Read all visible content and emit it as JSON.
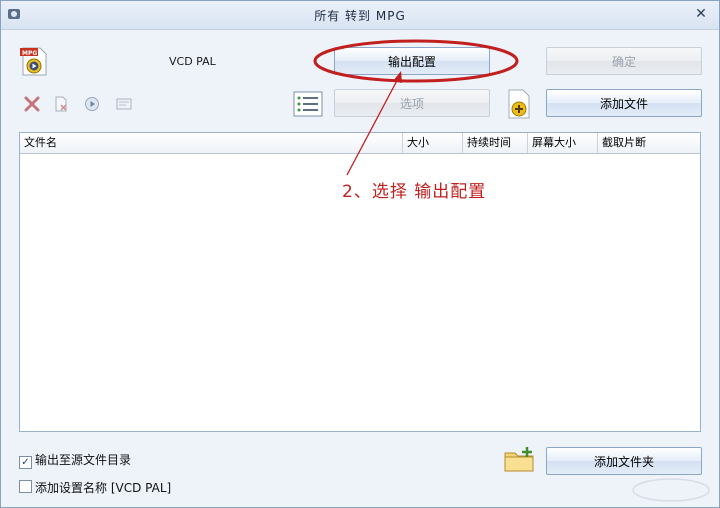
{
  "window": {
    "title": "所有 转到 MPG",
    "close_glyph": "✕"
  },
  "profile": {
    "icon_label": "MPG",
    "name": "VCD PAL"
  },
  "buttons": {
    "output_config": "输出配置",
    "ok": "确定",
    "options": "选项",
    "add_file": "添加文件",
    "add_folder": "添加文件夹"
  },
  "toolbar_icons": [
    "delete-icon",
    "remove-icon",
    "play-icon",
    "info-icon",
    "list-icon"
  ],
  "table": {
    "columns": [
      "文件名",
      "大小",
      "持续时间",
      "屏幕大小",
      "截取片断"
    ],
    "rows": []
  },
  "options": {
    "output_to_source": {
      "label": "输出至源文件目录",
      "checked": true
    },
    "add_setting_name": {
      "label": "添加设置名称 [VCD PAL]",
      "checked": false
    }
  },
  "annotation": {
    "text": "2、选择 输出配置",
    "color": "#c21f1f"
  },
  "colors": {
    "accent_border": "#8da5c6",
    "annotation_red": "#c21f1f"
  }
}
